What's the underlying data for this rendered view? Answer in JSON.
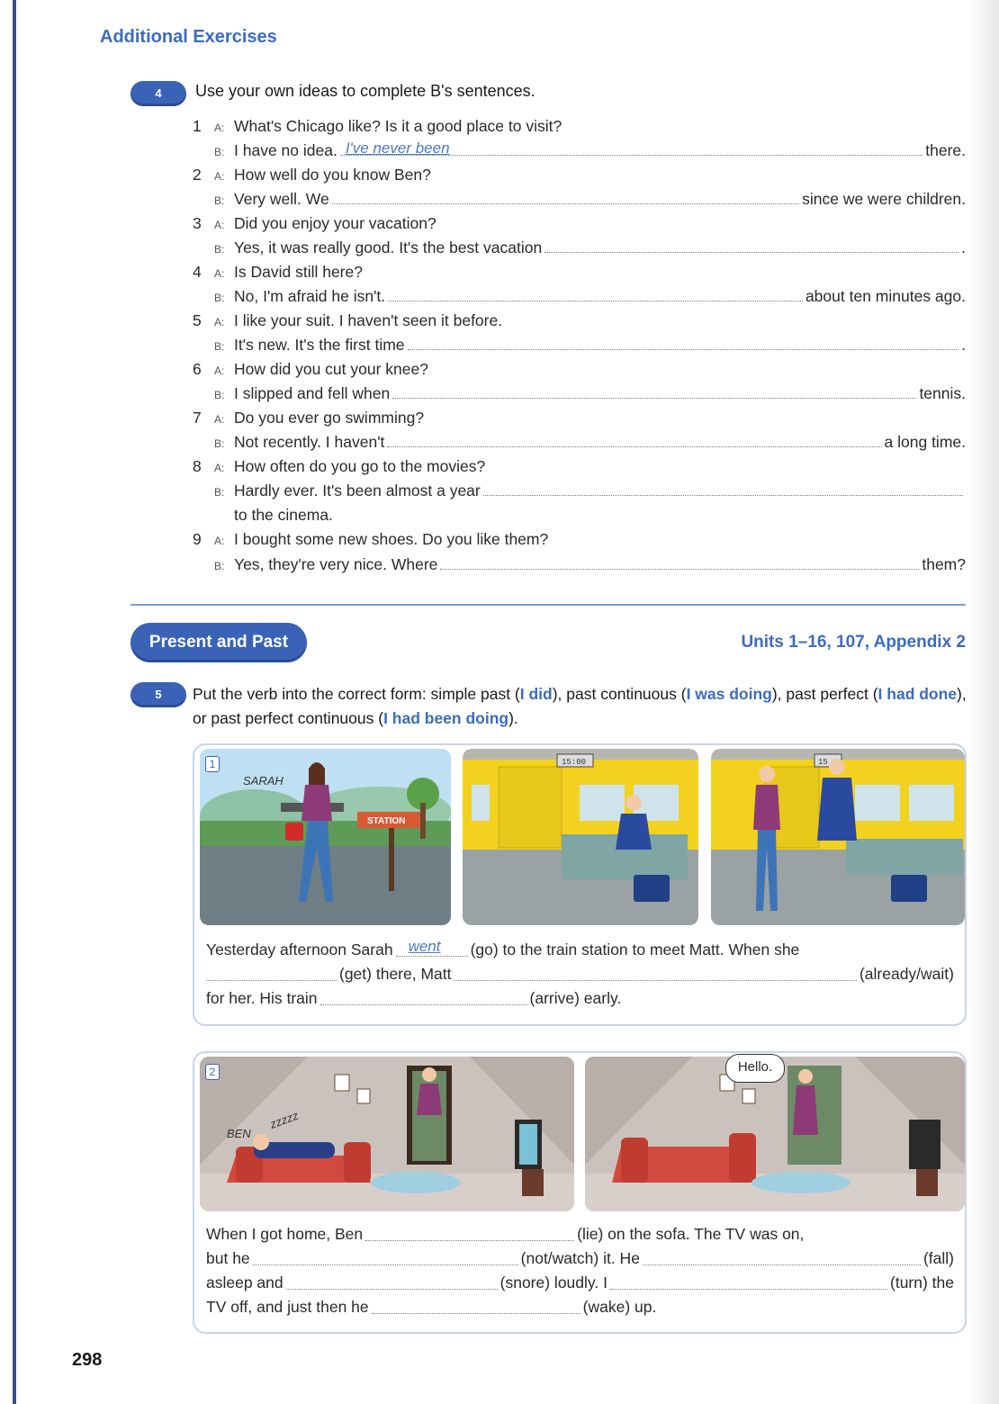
{
  "header": {
    "title": "Additional Exercises"
  },
  "ex4": {
    "number": "4",
    "instruction": "Use your own ideas to complete B's sentences.",
    "items": [
      {
        "n": "1",
        "a": "What's Chicago like? Is it a good place to visit?",
        "b_pre": "I have no idea.",
        "b_ans": "I've never been",
        "b_post": "there."
      },
      {
        "n": "2",
        "a": "How well do you know Ben?",
        "b_pre": "Very well. We",
        "b_ans": "",
        "b_post": "since we were children."
      },
      {
        "n": "3",
        "a": "Did you enjoy your vacation?",
        "b_pre": "Yes, it was really good. It's the best vacation",
        "b_ans": "",
        "b_post": "."
      },
      {
        "n": "4",
        "a": "Is David still here?",
        "b_pre": "No, I'm afraid he isn't.",
        "b_ans": "",
        "b_post": "about ten minutes ago."
      },
      {
        "n": "5",
        "a": "I like your suit. I haven't seen it before.",
        "b_pre": "It's new. It's the first time",
        "b_ans": "",
        "b_post": "."
      },
      {
        "n": "6",
        "a": "How did you cut your knee?",
        "b_pre": "I slipped and fell when",
        "b_ans": "",
        "b_post": "tennis."
      },
      {
        "n": "7",
        "a": "Do you ever go swimming?",
        "b_pre": "Not recently. I haven't",
        "b_ans": "",
        "b_post": "a long time."
      },
      {
        "n": "8",
        "a": "How often do you go to the movies?",
        "b_pre": "Hardly ever. It's been almost a year",
        "b_ans": "",
        "b_post": "",
        "b_cont": "to the cinema."
      },
      {
        "n": "9",
        "a": "I bought some new shoes. Do you like them?",
        "b_pre": "Yes, they're very nice. Where",
        "b_ans": "",
        "b_post": "them?"
      }
    ],
    "speaker_a": "A:",
    "speaker_b": "B:"
  },
  "section": {
    "title": "Present and Past",
    "units": "Units 1–16, 107, Appendix 2"
  },
  "ex5": {
    "number": "5",
    "instr_1": "Put the verb into the correct form: simple past (",
    "f1": "I did",
    "instr_2": "), past continuous (",
    "f2": "I was doing",
    "instr_3": "), past perfect (",
    "f3": "I had done",
    "instr_4": "), or past perfect continuous (",
    "f4": "I had been doing",
    "instr_5": ")."
  },
  "box1": {
    "pic_num": "1",
    "sarah_label": "SARAH",
    "station_sign": "STATION",
    "clock": "15:00",
    "clock2": "15",
    "l1_pre": "Yesterday afternoon Sarah",
    "l1_ans": "went",
    "l1_post": "(go) to the train station to meet Matt.  When she",
    "l2_a": "(get) there, Matt",
    "l2_b": "(already/wait)",
    "l3_pre": "for her.  His train",
    "l3_post": "(arrive) early."
  },
  "box2": {
    "pic_num": "2",
    "ben_label": "BEN",
    "zzz": "zzzzz",
    "hello": "Hello.",
    "l1_pre": "When I got home, Ben",
    "l1_post": "(lie) on the sofa.  The TV was on,",
    "l2_pre": "but he",
    "l2_mid": "(not/watch) it.  He",
    "l2_post": "(fall)",
    "l3_pre": "asleep and",
    "l3_mid": "(snore) loudly.  I",
    "l3_post": "(turn) the",
    "l4_pre": "TV off, and just then he",
    "l4_post": "(wake) up."
  },
  "page_number": "298",
  "colors": {
    "accent": "#3b6cc0",
    "pill": "#3a63b8",
    "answer": "#4b78c6"
  }
}
